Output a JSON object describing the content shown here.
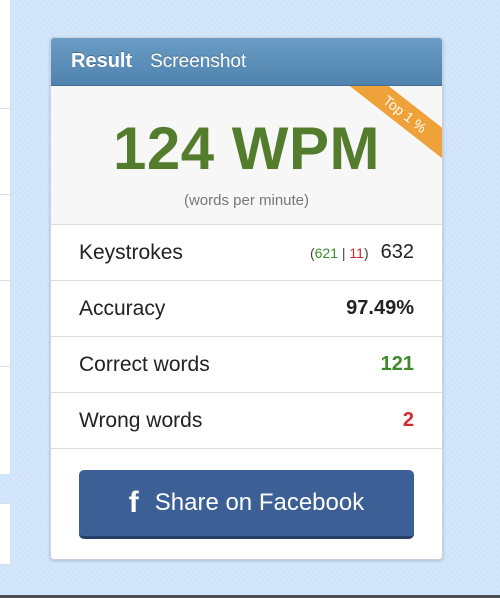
{
  "card": {
    "tabs": [
      {
        "label": "Result",
        "active": true
      },
      {
        "label": "Screenshot",
        "active": false
      }
    ],
    "wpm": {
      "value": "124 WPM",
      "caption": "(words per minute)",
      "rank_badge": "Top 1 %"
    },
    "stats": {
      "keystrokes": {
        "label": "Keystrokes",
        "correct": "621",
        "separator": "|",
        "wrong": "11",
        "open": "(",
        "close": ")",
        "total": "632"
      },
      "accuracy": {
        "label": "Accuracy",
        "value": "97.49%"
      },
      "correct_words": {
        "label": "Correct words",
        "value": "121"
      },
      "wrong_words": {
        "label": "Wrong words",
        "value": "2"
      }
    },
    "share": {
      "icon": "facebook-icon",
      "icon_glyph": "f",
      "label": "Share on Facebook"
    }
  },
  "colors": {
    "wpm": "#537c2c",
    "correct": "#3c8a2b",
    "wrong": "#d42a2a",
    "ribbon": "#f0a23a",
    "facebook": "#3c5f96",
    "header": "#5b8db7"
  }
}
